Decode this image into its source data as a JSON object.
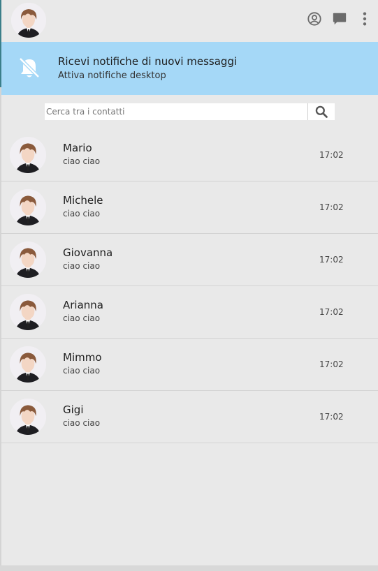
{
  "header": {
    "profile_icon": "user-circle-icon",
    "chat_icon": "chat-bubble-icon",
    "menu_icon": "more-vertical-icon"
  },
  "notification_banner": {
    "icon": "bell-off-icon",
    "title": "Ricevi notifiche di nuovi messaggi",
    "subtitle": "Attiva notifiche desktop"
  },
  "search": {
    "placeholder": "Cerca tra i contatti",
    "value": "",
    "icon": "search-icon"
  },
  "contacts": [
    {
      "name": "Mario",
      "last_message": "ciao ciao",
      "time": "17:02"
    },
    {
      "name": "Michele",
      "last_message": "ciao ciao",
      "time": "17:02"
    },
    {
      "name": "Giovanna",
      "last_message": "ciao ciao",
      "time": "17:02"
    },
    {
      "name": "Arianna",
      "last_message": "ciao ciao",
      "time": "17:02"
    },
    {
      "name": "Mimmo",
      "last_message": "ciao ciao",
      "time": "17:02"
    },
    {
      "name": "Gigi",
      "last_message": "ciao ciao",
      "time": "17:02"
    }
  ],
  "colors": {
    "background": "#e9e9e9",
    "banner": "#a5d8f7",
    "divider": "#d3d3d3",
    "icon": "#6b6b6b"
  }
}
